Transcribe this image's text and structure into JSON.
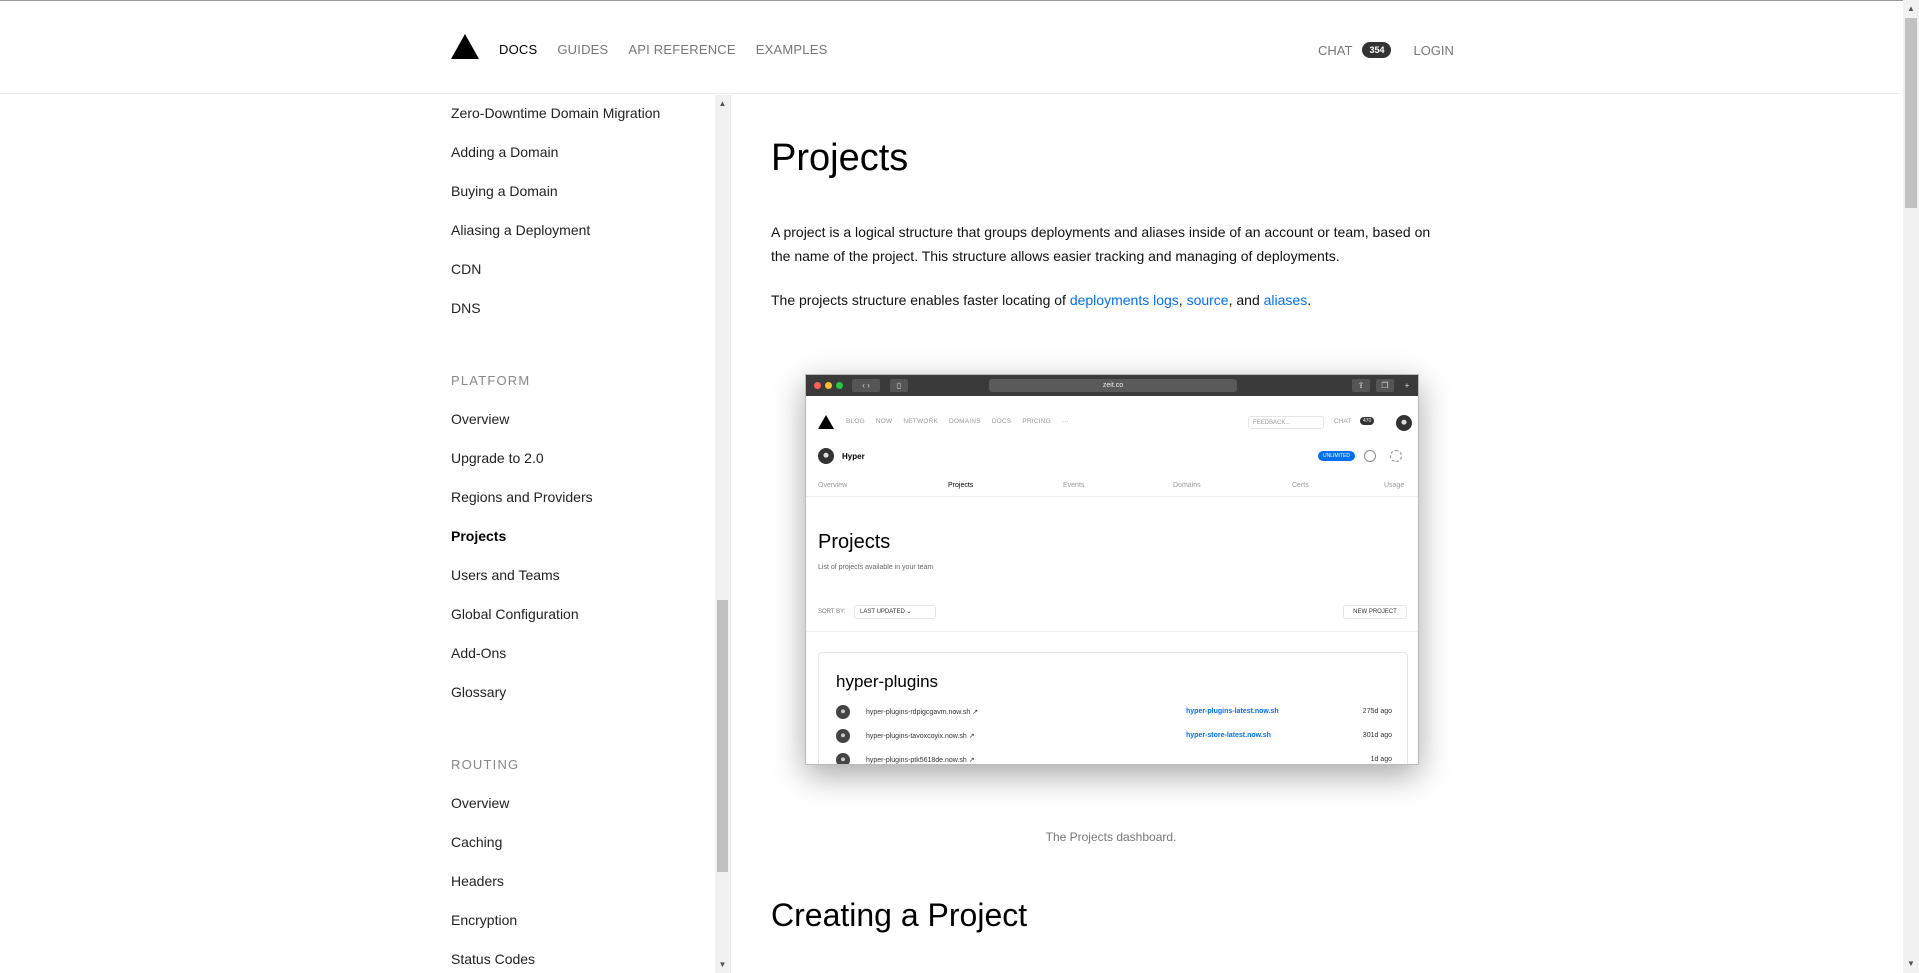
{
  "header": {
    "nav": [
      "DOCS",
      "GUIDES",
      "API REFERENCE",
      "EXAMPLES"
    ],
    "chat_label": "CHAT",
    "chat_count": "354",
    "login_label": "LOGIN"
  },
  "sidebar": {
    "group_top": [
      "Zero-Downtime Domain Migration",
      "Adding a Domain",
      "Buying a Domain",
      "Aliasing a Deployment",
      "CDN",
      "DNS"
    ],
    "platform_heading": "PLATFORM",
    "platform": [
      "Overview",
      "Upgrade to 2.0",
      "Regions and Providers",
      "Projects",
      "Users and Teams",
      "Global Configuration",
      "Add-Ons",
      "Glossary"
    ],
    "active_item": "Projects",
    "routing_heading": "ROUTING",
    "routing": [
      "Overview",
      "Caching",
      "Headers",
      "Encryption",
      "Status Codes"
    ]
  },
  "main": {
    "title": "Projects",
    "para1": "A project is a logical structure that groups deployments and aliases inside of an account or team, based on the name of the project. This structure allows easier tracking and managing of deployments.",
    "para2_prefix": "The projects structure enables faster locating of ",
    "link_deployments_logs": "deployments logs",
    "sep1": ", ",
    "link_source": "source",
    "sep2": ", and ",
    "link_aliases": "aliases",
    "para2_suffix": ".",
    "caption": "The Projects dashboard.",
    "section_title": "Creating a Project"
  },
  "figure": {
    "url": "zeit.co",
    "nav": [
      "BLOG",
      "NOW",
      "NETWORK",
      "DOMAINS",
      "DOCS",
      "PRICING",
      "···"
    ],
    "feedback_placeholder": "FEEDBACK...",
    "chat_label": "CHAT",
    "chat_count": "470",
    "team_name": "Hyper",
    "plan_badge": "UNLIMITED",
    "tabs": [
      "Overview",
      "Projects",
      "Events",
      "Domains",
      "Certs",
      "Usage"
    ],
    "active_tab": "Projects",
    "heading": "Projects",
    "subheading": "List of projects available in your team",
    "sort_label": "SORT BY:",
    "sort_value": "LAST UPDATED",
    "new_project": "NEW PROJECT",
    "project_name": "hyper-plugins",
    "rows": [
      {
        "deployment": "hyper-plugins-rdpigcgavm.now.sh",
        "alias": "hyper-plugins-latest.now.sh",
        "age": "275d ago"
      },
      {
        "deployment": "hyper-plugins-tavoxcoyix.now.sh",
        "alias": "hyper-store-latest.now.sh",
        "age": "301d ago"
      },
      {
        "deployment": "hyper-plugins-ptk5618de.now.sh",
        "alias": "",
        "age": "1d ago"
      }
    ]
  },
  "colors": {
    "link": "#0070f3",
    "badge": "#333333"
  }
}
